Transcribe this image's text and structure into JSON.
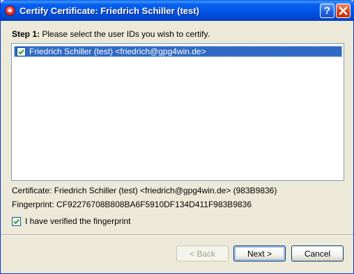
{
  "window": {
    "title": "Certify Certificate: Friedrich Schiller (test)",
    "help_glyph": "?",
    "close_icon": "close-icon"
  },
  "step": {
    "number_label": "Step 1:",
    "text": " Please select the user IDs you wish to certify."
  },
  "user_ids": [
    {
      "label": "Friedrich Schiller (test) <friedrich@gpg4win.de>",
      "checked": true,
      "selected": true
    }
  ],
  "certificate": {
    "line": "Certificate: Friedrich Schiller (test) <friedrich@gpg4win.de> (983B9836)",
    "fingerprint_line": "Fingerprint: CF92276708B808BA6F5910DF134D411F983B9836"
  },
  "verify": {
    "label": "I have verified the fingerprint",
    "checked": true
  },
  "buttons": {
    "back": "< Back",
    "next": "Next >",
    "cancel": "Cancel"
  },
  "colors": {
    "titlebar": "#0055e5",
    "selection": "#316ac5",
    "checkmark": "#21a121",
    "close_button": "#d9401a"
  }
}
